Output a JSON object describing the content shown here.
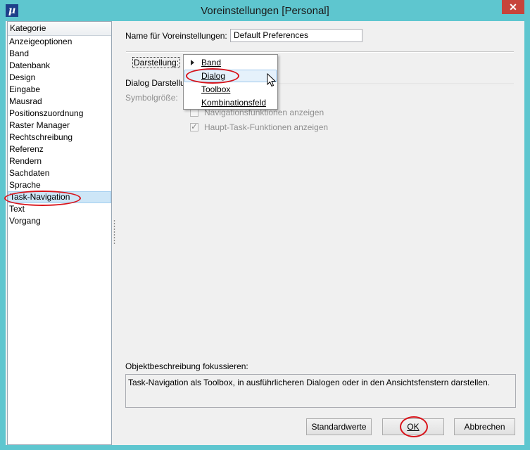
{
  "window": {
    "title": "Voreinstellungen [Personal]",
    "app_icon_glyph": "µ",
    "close_glyph": "✕"
  },
  "categories": {
    "header": "Kategorie",
    "items": [
      "Anzeigeoptionen",
      "Band",
      "Datenbank",
      "Design",
      "Eingabe",
      "Mausrad",
      "Positionszuordnung",
      "Raster Manager",
      "Rechtschreibung",
      "Referenz",
      "Rendern",
      "Sachdaten",
      "Sprache",
      "Task-Navigation",
      "Text",
      "Vorgang"
    ],
    "selected": "Task-Navigation"
  },
  "form": {
    "name_label": "Name für Voreinstellungen:",
    "name_value": "Default Preferences",
    "darstellung_label": "Darstellung:",
    "dialog_section_label": "Dialog Darstellu",
    "symbol_size_label": "Symbolgröße:",
    "checkbox_nav_label": "Navigationsfunktionen anzeigen",
    "checkbox_haupt_label": "Haupt-Task-Funktionen anzeigen"
  },
  "dropdown": {
    "options": [
      "Band",
      "Dialog",
      "Toolbox",
      "Kombinationsfeld"
    ],
    "current": "Band",
    "hovered": "Dialog"
  },
  "description": {
    "label": "Objektbeschreibung fokussieren:",
    "text": "Task-Navigation als Toolbox, in ausführlicheren Dialogen oder in den Ansichtsfenstern darstellen."
  },
  "buttons": {
    "defaults": "Standardwerte",
    "ok": "OK",
    "cancel": "Abbrechen"
  },
  "colors": {
    "titlebar": "#5ec6cf",
    "annotation": "#d9141b",
    "selection": "#cde6f7"
  }
}
